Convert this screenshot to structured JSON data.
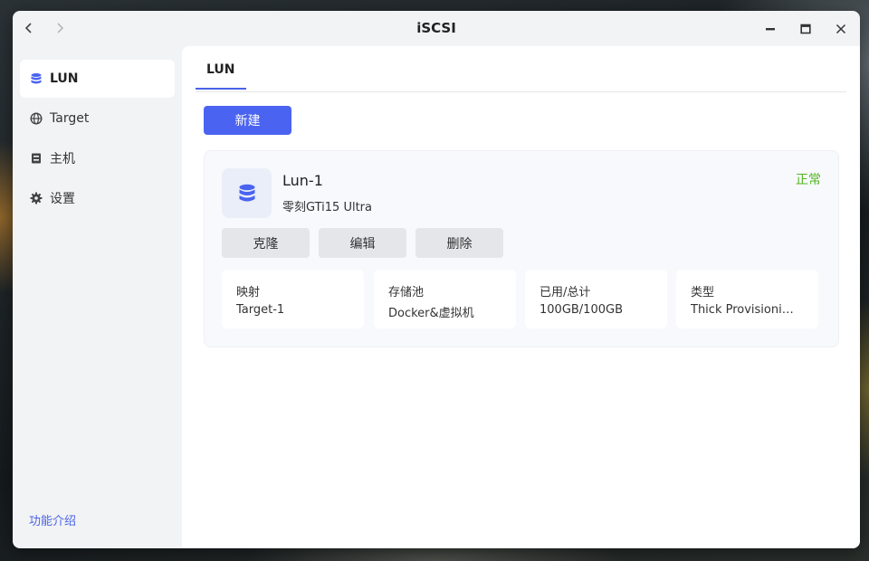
{
  "window": {
    "title": "iSCSI"
  },
  "sidebar": {
    "items": [
      {
        "label": "LUN",
        "icon": "database-icon",
        "active": true
      },
      {
        "label": "Target",
        "icon": "globe-icon",
        "active": false
      },
      {
        "label": "主机",
        "icon": "server-icon",
        "active": false
      },
      {
        "label": "设置",
        "icon": "gear-icon",
        "active": false
      }
    ],
    "intro_link": "功能介绍"
  },
  "main": {
    "tabs": [
      {
        "label": "LUN"
      }
    ],
    "new_button": "新建",
    "lun_card": {
      "name": "Lun-1",
      "device": "零刻GTi15 Ultra",
      "status": "正常",
      "actions": [
        "克隆",
        "编辑",
        "删除"
      ],
      "info": [
        {
          "label": "映射",
          "value": "Target-1"
        },
        {
          "label": "存储池",
          "value": "Docker&虚拟机"
        },
        {
          "label": "已用/总计",
          "value": "100GB/100GB"
        },
        {
          "label": "类型",
          "value": "Thick Provisioni…"
        }
      ]
    }
  },
  "colors": {
    "accent": "#4a63f0",
    "status_ok": "#52b520",
    "sidebar_bg": "#f2f3f5",
    "card_bg": "#f7f9fc"
  }
}
